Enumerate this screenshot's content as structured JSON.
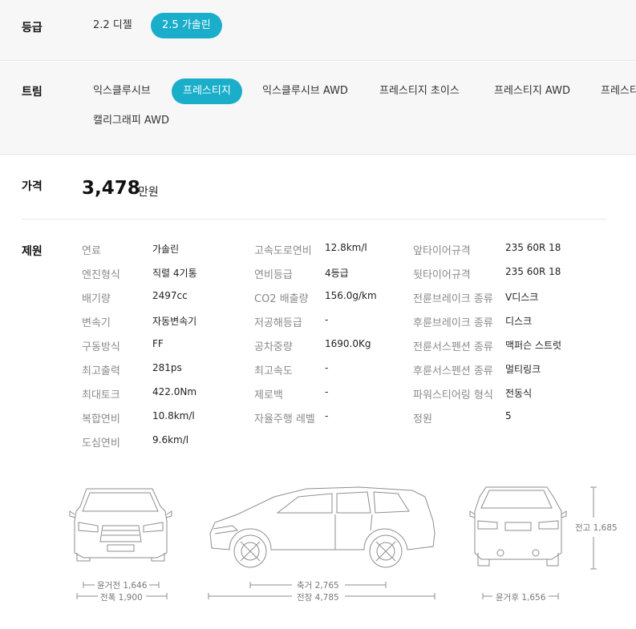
{
  "grade": {
    "label": "등급",
    "options": [
      {
        "label": "2.2 디젤",
        "active": false
      },
      {
        "label": "2.5 가솔린",
        "active": true
      }
    ]
  },
  "trim": {
    "label": "트림",
    "options": [
      {
        "label": "익스클루시브",
        "active": false
      },
      {
        "label": "프레스티지",
        "active": true
      },
      {
        "label": "익스클루시브 AWD",
        "active": false
      },
      {
        "label": "프레스티지 초이스",
        "active": false
      },
      {
        "label": "프레스티지 AWD",
        "active": false
      },
      {
        "label": "프레스티",
        "active": false
      },
      {
        "label": "캘리그래피 AWD",
        "active": false
      }
    ]
  },
  "price": {
    "label": "가격",
    "value": "3,478",
    "unit": "만원"
  },
  "specs": {
    "label": "제원",
    "col1": [
      {
        "label": "연료",
        "value": "가솔린"
      },
      {
        "label": "엔진형식",
        "value": "직렬 4기통"
      },
      {
        "label": "배기량",
        "value": "2497cc"
      },
      {
        "label": "변속기",
        "value": "자동변속기"
      },
      {
        "label": "구동방식",
        "value": "FF"
      },
      {
        "label": "최고출력",
        "value": "281ps"
      },
      {
        "label": "최대토크",
        "value": "422.0Nm"
      },
      {
        "label": "복합연비",
        "value": "10.8km/l"
      },
      {
        "label": "도심연비",
        "value": "9.6km/l"
      }
    ],
    "col2": [
      {
        "label": "고속도로연비",
        "value": "12.8km/l"
      },
      {
        "label": "연비등급",
        "value": "4등급"
      },
      {
        "label": "CO2 배출량",
        "value": "156.0g/km"
      },
      {
        "label": "저공해등급",
        "value": "-"
      },
      {
        "label": "공차중량",
        "value": "1690.0Kg"
      },
      {
        "label": "최고속도",
        "value": "-"
      },
      {
        "label": "제로백",
        "value": "-"
      },
      {
        "label": "자율주행 레벨",
        "value": "-"
      }
    ],
    "col3": [
      {
        "label": "앞타이어규격",
        "value": "235 60R 18"
      },
      {
        "label": "뒷타이어규격",
        "value": "235 60R 18"
      },
      {
        "label": "전륜브레이크 종류",
        "value": "V디스크"
      },
      {
        "label": "후륜브레이크 종류",
        "value": "디스크"
      },
      {
        "label": "전륜서스펜션 종류",
        "value": "맥퍼슨 스트럿"
      },
      {
        "label": "후륜서스펜션 종류",
        "value": "멀티링크"
      },
      {
        "label": "파워스티어링 형식",
        "value": "전동식"
      },
      {
        "label": "정원",
        "value": "5"
      }
    ]
  },
  "dimensions": {
    "front_track": "윤거전 1,646",
    "width": "전폭 1,900",
    "wheelbase": "축거 2,765",
    "length": "전장 4,785",
    "rear_track": "윤거후 1,656",
    "height": "전고 1,685"
  }
}
